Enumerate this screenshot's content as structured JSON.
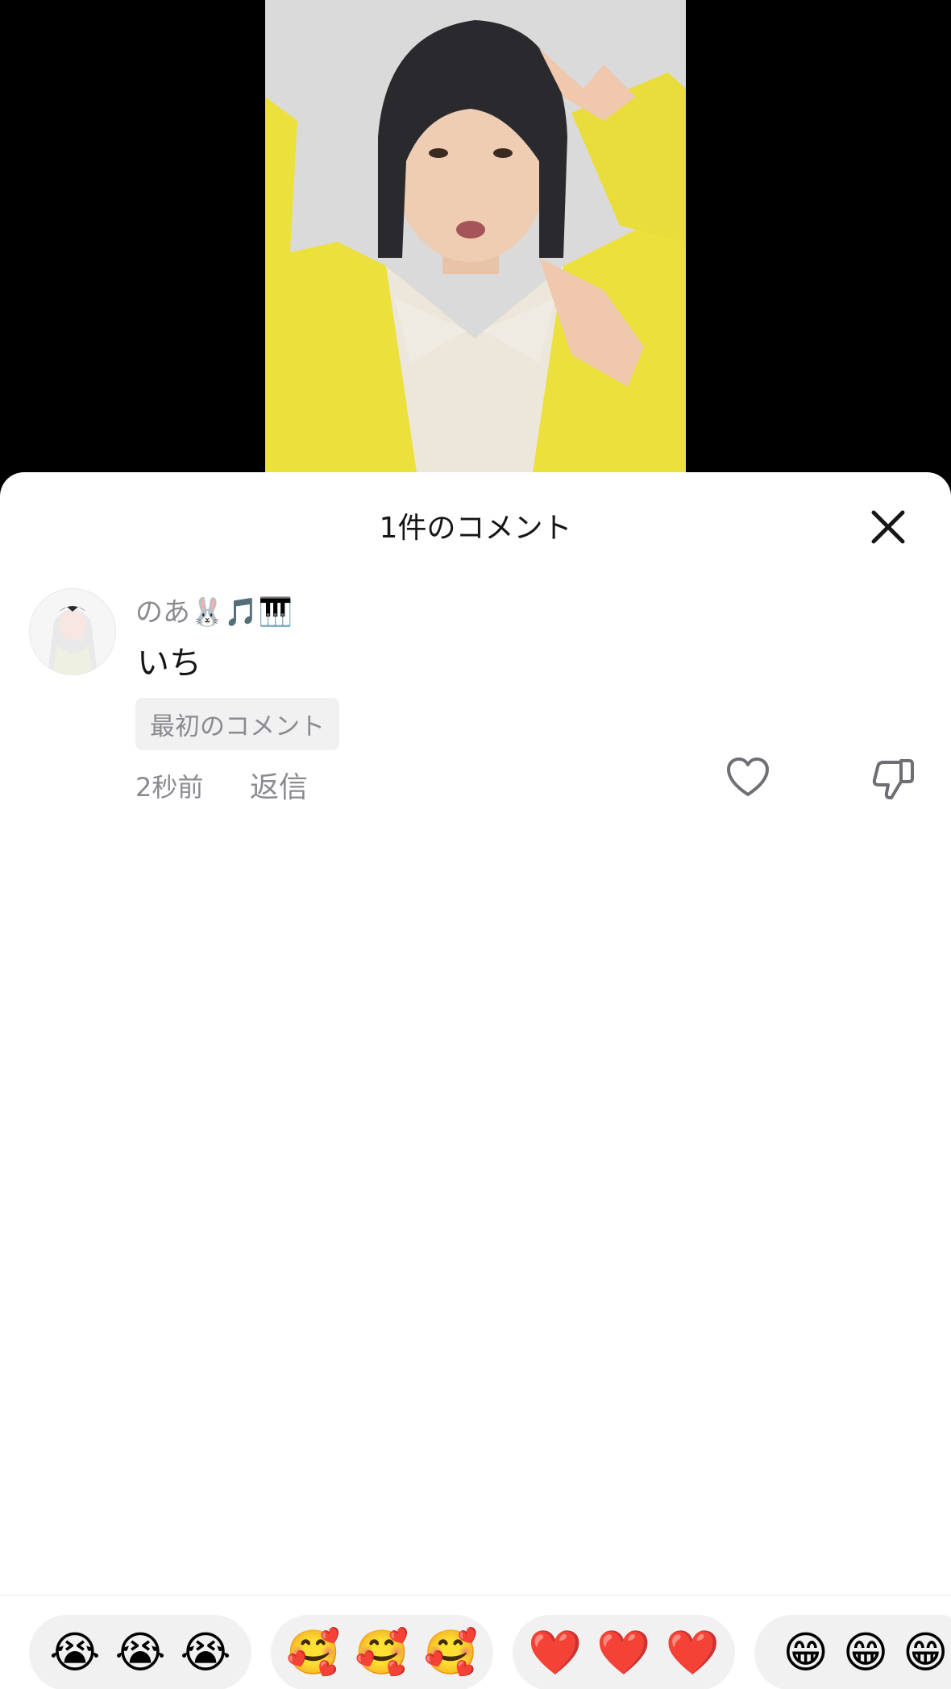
{
  "sheet": {
    "title": "1件のコメント"
  },
  "comment": {
    "username": "のあ🐰🎵🎹",
    "text": "いち",
    "badge": "最初のコメント",
    "time": "2秒前",
    "reply_label": "返信"
  },
  "emoji_bar": [
    {
      "emoji": "😭",
      "count_shown": 3,
      "label": "😭😭😭"
    },
    {
      "emoji": "🥰",
      "count_shown": 3,
      "label": "🥰🥰🥰"
    },
    {
      "emoji": "❤️",
      "count_shown": 3,
      "label": "❤️❤️❤️"
    },
    {
      "emoji": "😁",
      "count_shown": 3,
      "label": "😁😁😁"
    }
  ],
  "icons": {
    "close": "close-icon",
    "like": "heart-icon",
    "dislike": "thumbs-down-icon"
  }
}
